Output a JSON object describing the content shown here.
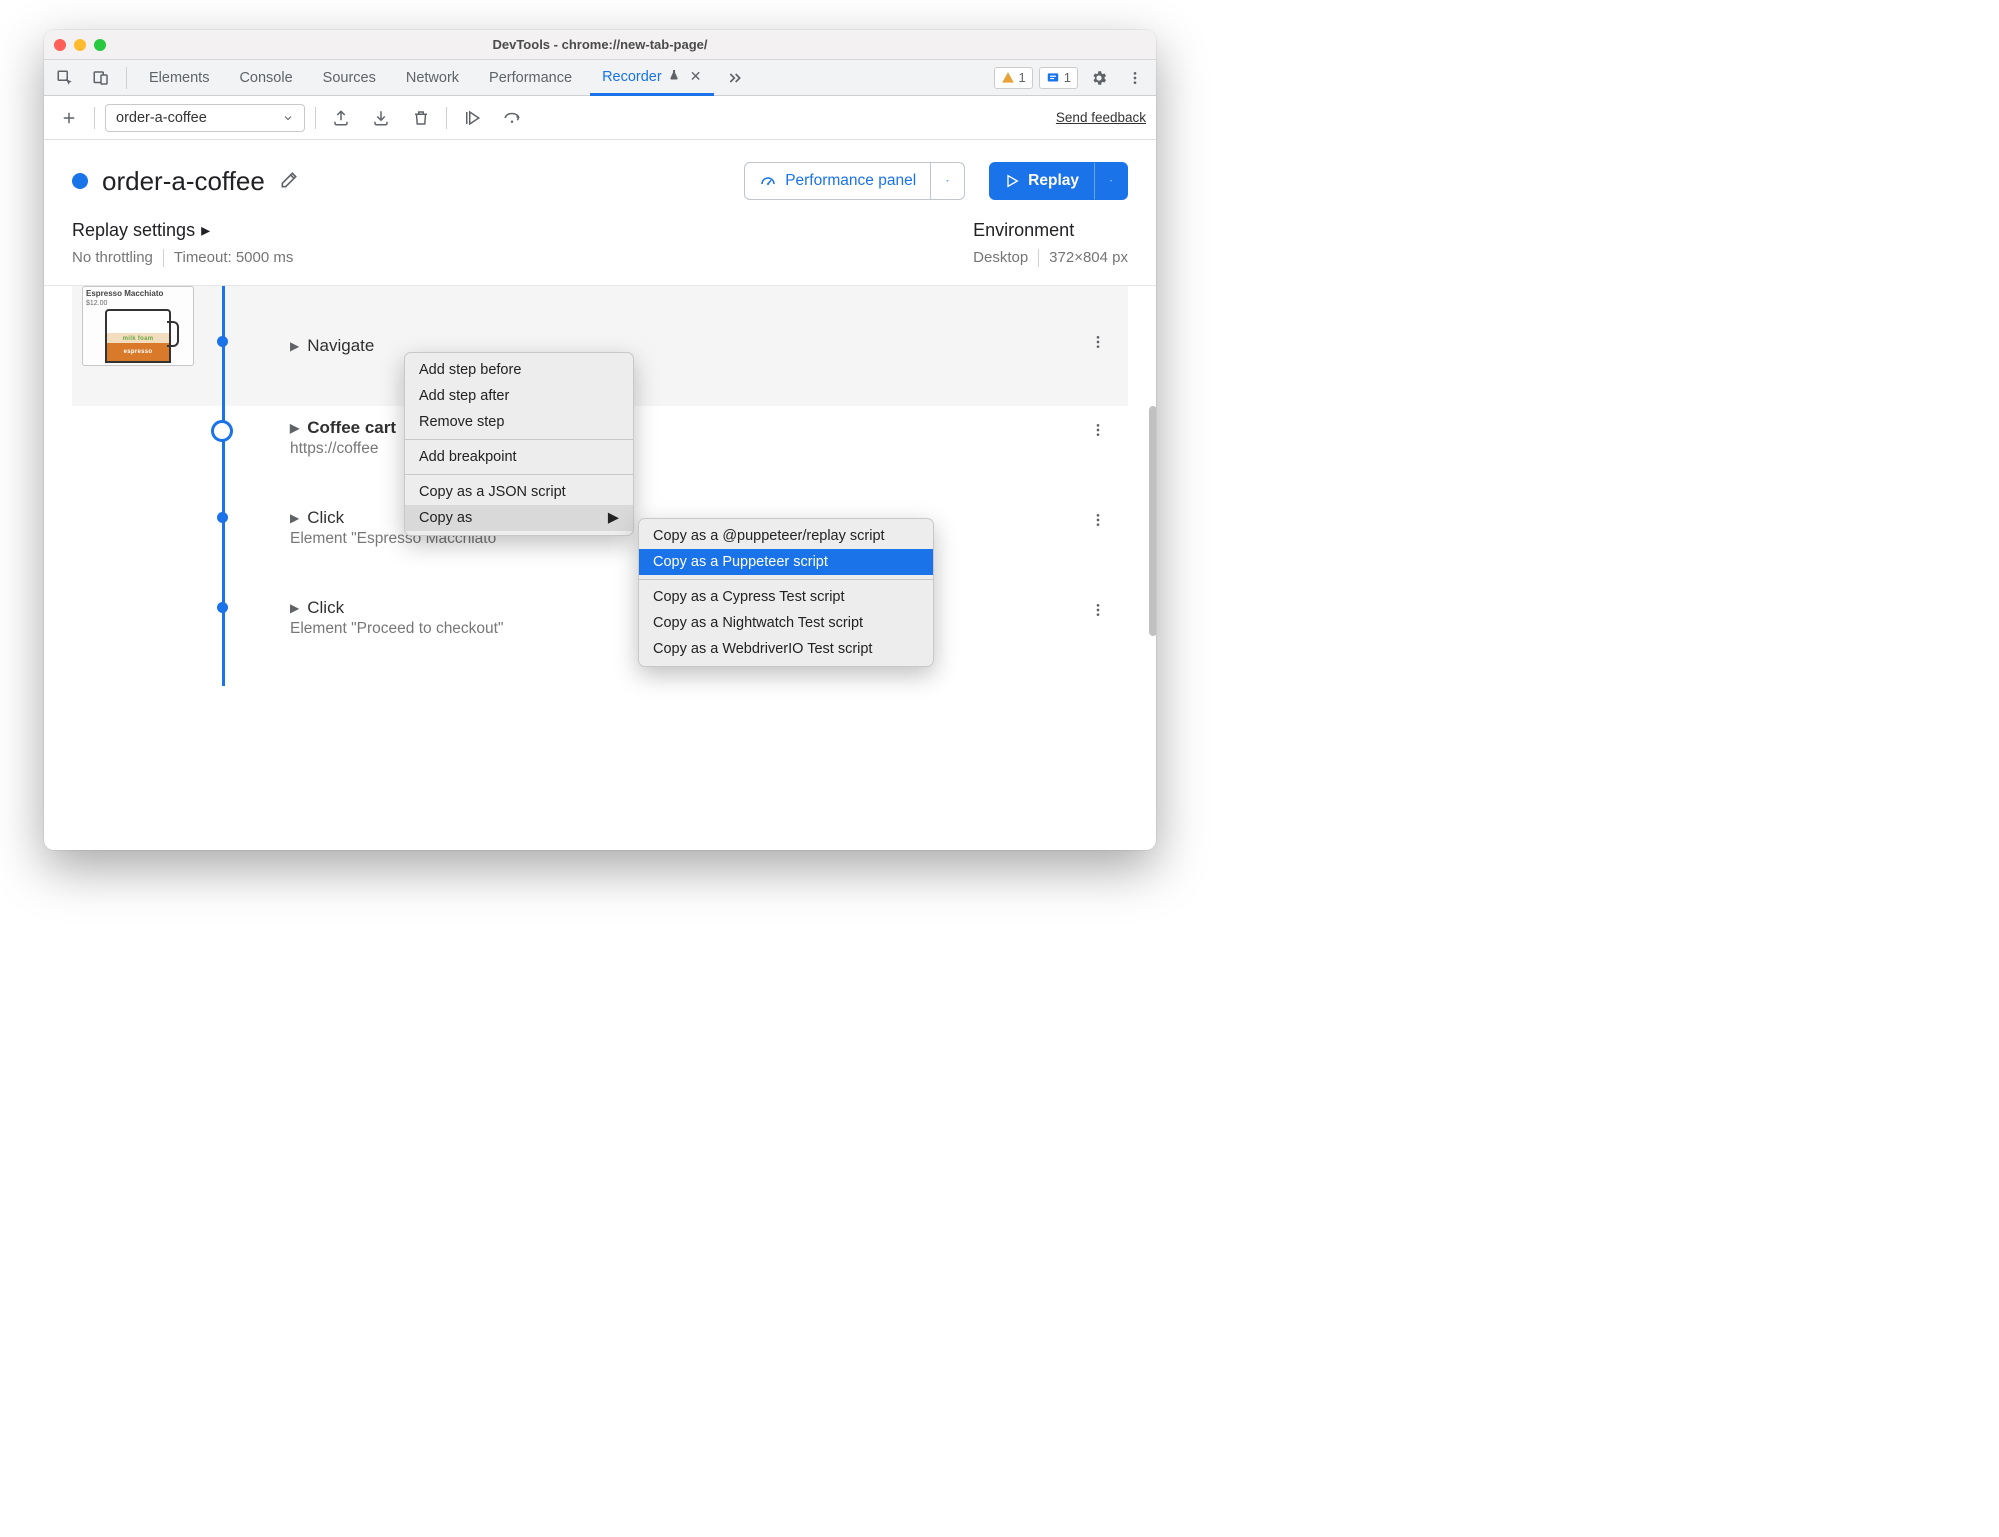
{
  "titlebar": {
    "title": "DevTools - chrome://new-tab-page/"
  },
  "tabs": {
    "elements": "Elements",
    "console": "Console",
    "sources": "Sources",
    "network": "Network",
    "performance": "Performance",
    "recorder": "Recorder"
  },
  "badges": {
    "warn": "1",
    "issue": "1"
  },
  "toolbar": {
    "recording_name": "order-a-coffee",
    "send_feedback": "Send feedback"
  },
  "header": {
    "title": "order-a-coffee",
    "perf_btn": "Performance panel",
    "replay_btn": "Replay"
  },
  "settings": {
    "replay_title": "Replay settings",
    "throttling": "No throttling",
    "timeout": "Timeout: 5000 ms",
    "env_title": "Environment",
    "device": "Desktop",
    "dimensions": "372×804 px"
  },
  "thumb": {
    "label": "Espresso Macchiato",
    "price": "$12.00",
    "foam": "milk foam",
    "espresso": "espresso"
  },
  "steps": {
    "navigate": {
      "title": "Navigate"
    },
    "coffee": {
      "title": "Coffee cart",
      "url": "https://coffee"
    },
    "click1": {
      "title": "Click",
      "sub": "Element \"Espresso Macchiato\""
    },
    "click2": {
      "title": "Click",
      "sub": "Element \"Proceed to checkout\""
    }
  },
  "ctx1": {
    "add_before": "Add step before",
    "add_after": "Add step after",
    "remove": "Remove step",
    "breakpoint": "Add breakpoint",
    "copy_json": "Copy as a JSON script",
    "copy_as": "Copy as"
  },
  "ctx2": {
    "puppeteer_replay": "Copy as a @puppeteer/replay script",
    "puppeteer": "Copy as a Puppeteer script",
    "cypress": "Copy as a Cypress Test script",
    "nightwatch": "Copy as a Nightwatch Test script",
    "webdriverio": "Copy as a WebdriverIO Test script"
  }
}
